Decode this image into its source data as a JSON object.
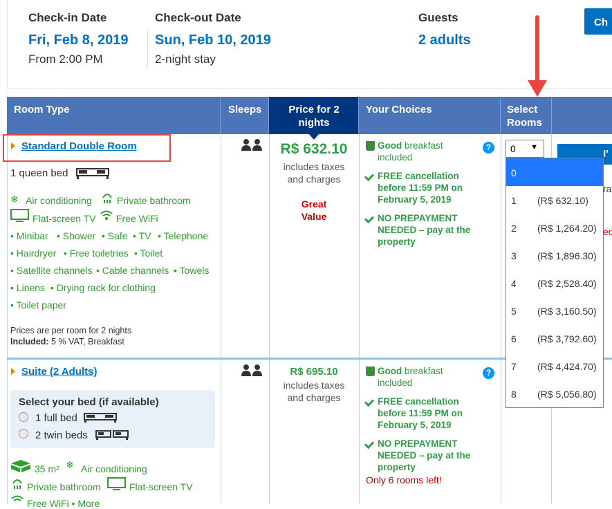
{
  "summary": {
    "checkin_label": "Check-in Date",
    "checkin_date": "Fri, Feb 8, 2019",
    "checkin_time": "From 2:00 PM",
    "checkout_label": "Check-out Date",
    "checkout_date": "Sun, Feb 10, 2019",
    "checkout_stay": "2-night stay",
    "guests_label": "Guests",
    "guests_value": "2 adults",
    "change_button": "Ch"
  },
  "table_header": {
    "room_type": "Room Type",
    "sleeps": "Sleeps",
    "price_line1": "Price for 2",
    "price_line2": "nights",
    "your_choices": "Your Choices",
    "select_line1": "Select",
    "select_line2": "Rooms"
  },
  "room1": {
    "name": "Standard Double Room",
    "bed": "1 queen bed",
    "amenities_icon": [
      "Air conditioning",
      "Private bathroom",
      "Flat-screen TV",
      "Free WiFi"
    ],
    "facilities": [
      "Minibar",
      "Shower",
      "Safe",
      "TV",
      "Telephone",
      "Hairdryer",
      "Free toiletries",
      "Toilet",
      "Satellite channels",
      "Cable channels",
      "Towels",
      "Linens",
      "Drying rack for clothing",
      "Toilet paper"
    ],
    "prices_note": "Prices are per room for 2 nights",
    "included_label": "Included:",
    "included_value": "5 % VAT, Breakfast",
    "price": "R$ 632.10",
    "price_note_1": "includes taxes",
    "price_note_2": "and charges",
    "great_1": "Great",
    "great_2": "Value",
    "choice_breakfast_bold": "Good",
    "choice_breakfast_rest": "breakfast",
    "choice_breakfast_l2": "included",
    "choice_cancel_1": "FREE cancellation",
    "choice_cancel_2": "before 11:59 PM on",
    "choice_cancel_3": "February 5, 2019",
    "choice_prepay_1": "NO PREPAYMENT",
    "choice_prepay_2": "NEEDED – pay at the",
    "choice_prepay_3": "property"
  },
  "room2": {
    "name": "Suite (2 Adults)",
    "bed_select_title": "Select your bed (if available)",
    "bed_opt1": "1 full bed",
    "bed_opt2": "2 twin beds",
    "size": "35 m²",
    "amenity_ac": "Air conditioning",
    "amenity_bath": "Private bathroom",
    "amenity_tv": "Flat-screen TV",
    "amenity_wifi_cut": "Free WiFi • More",
    "price": "R$ 695.10",
    "price_note_1": "includes taxes",
    "price_note_2": "and charges",
    "choice_breakfast_bold": "Good",
    "choice_breakfast_rest": "breakfast",
    "choice_breakfast_l2": "included",
    "choice_cancel_1": "FREE cancellation",
    "choice_cancel_2": "before 11:59 PM on",
    "choice_cancel_3": "February 5, 2019",
    "choice_prepay_1": "NO PREPAYMENT",
    "choice_prepay_2": "NEEDED – pay at the",
    "choice_prepay_3": "property",
    "only_left": "Only 6 rooms left!"
  },
  "select_rooms": {
    "current": "0",
    "options": [
      {
        "n": "0",
        "price": ""
      },
      {
        "n": "1",
        "price": "(R$ 632.10)"
      },
      {
        "n": "2",
        "price": "(R$ 1,264.20)"
      },
      {
        "n": "3",
        "price": "(R$ 1,896.30)"
      },
      {
        "n": "4",
        "price": "(R$ 2,528.40)"
      },
      {
        "n": "5",
        "price": "(R$ 3,160.50)"
      },
      {
        "n": "6",
        "price": "(R$ 3,792.60)"
      },
      {
        "n": "7",
        "price": "(R$ 4,424.70)"
      },
      {
        "n": "8",
        "price": "(R$ 5,056.80)"
      }
    ]
  },
  "peek_text": {
    "p1": "I'",
    "p2": "ra",
    "p3": "ec"
  },
  "colors": {
    "brand_blue": "#0071c2",
    "header_blue": "#4b75b8",
    "price_dark": "#003580",
    "green": "#2d9e45",
    "annotation_red": "#e8463c"
  }
}
